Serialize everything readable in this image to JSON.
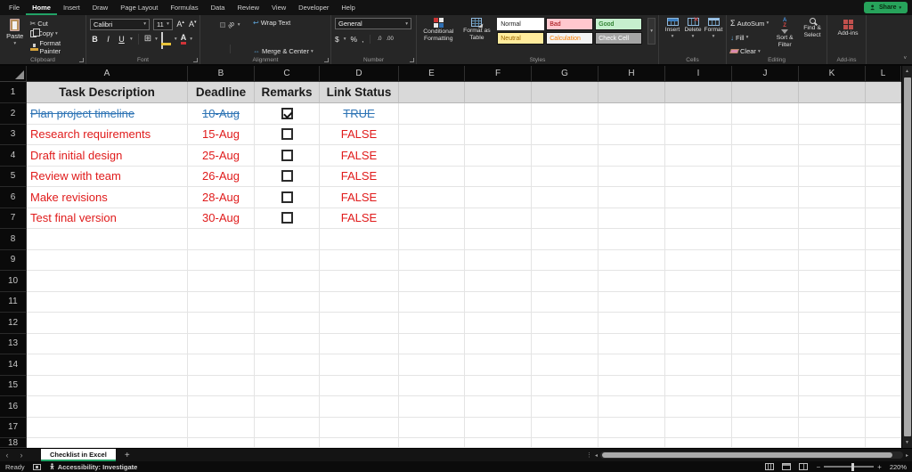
{
  "menu": {
    "items": [
      "File",
      "Home",
      "Insert",
      "Draw",
      "Page Layout",
      "Formulas",
      "Data",
      "Review",
      "View",
      "Developer",
      "Help"
    ],
    "active": "Home"
  },
  "titlebar": {
    "share_label": "Share"
  },
  "ribbon": {
    "clipboard": {
      "group_label": "Clipboard",
      "paste_label": "Paste",
      "cut_label": "Cut",
      "copy_label": "Copy",
      "format_painter_label": "Format Painter"
    },
    "font": {
      "group_label": "Font",
      "font_name": "Calibri",
      "font_size": "11",
      "bold": "B",
      "italic": "I",
      "underline": "U",
      "grow_font": "A",
      "shrink_font": "A"
    },
    "alignment": {
      "group_label": "Alignment",
      "wrap_text_label": "Wrap Text",
      "merge_center_label": "Merge & Center"
    },
    "number": {
      "group_label": "Number",
      "format_value": "General",
      "currency": "$",
      "percent": "%",
      "comma": ",",
      "increase_decimal": ".0",
      "decrease_decimal": ".00"
    },
    "styles": {
      "group_label": "Styles",
      "conditional_formatting_label": "Conditional Formatting",
      "format_as_table_label": "Format as Table",
      "cells": [
        {
          "name": "Normal",
          "bg": "#FFFFFF",
          "fg": "#1a1a1a",
          "emphasis": true
        },
        {
          "name": "Bad",
          "bg": "#FFC7CE",
          "fg": "#9C0006",
          "emphasis": false
        },
        {
          "name": "Good",
          "bg": "#C6EFCE",
          "fg": "#006100",
          "emphasis": false
        },
        {
          "name": "Neutral",
          "bg": "#FFEB9C",
          "fg": "#9C6500",
          "emphasis": false
        },
        {
          "name": "Calculation",
          "bg": "#F2F2F2",
          "fg": "#FA7D00",
          "emphasis": false
        },
        {
          "name": "Check Cell",
          "bg": "#A5A5A5",
          "fg": "#FFFFFF",
          "emphasis": false
        }
      ]
    },
    "cells": {
      "group_label": "Cells",
      "insert_label": "Insert",
      "delete_label": "Delete",
      "format_label": "Format"
    },
    "editing": {
      "group_label": "Editing",
      "autosum_label": "AutoSum",
      "fill_label": "Fill",
      "clear_label": "Clear",
      "sort_filter_label": "Sort & Filter",
      "find_select_label": "Find & Select"
    },
    "addins": {
      "group_label": "Add-ins",
      "button_label": "Add-ins"
    }
  },
  "grid": {
    "columns": [
      "A",
      "B",
      "C",
      "D",
      "E",
      "F",
      "G",
      "H",
      "I",
      "J",
      "K",
      "L"
    ],
    "row_numbers": [
      "1",
      "2",
      "3",
      "4",
      "5",
      "6",
      "7",
      "8",
      "9",
      "10",
      "11",
      "12",
      "13",
      "14",
      "15",
      "16",
      "17",
      "18"
    ],
    "header_row": [
      "Task Description",
      "Deadline",
      "Remarks",
      "Link Status"
    ],
    "tasks": [
      {
        "row": 2,
        "task": "Plan project timeline",
        "deadline": "10-Aug",
        "checked": true,
        "status": "TRUE",
        "done": true
      },
      {
        "row": 3,
        "task": "Research requirements",
        "deadline": "15-Aug",
        "checked": false,
        "status": "FALSE",
        "done": false
      },
      {
        "row": 4,
        "task": "Draft initial design",
        "deadline": "25-Aug",
        "checked": false,
        "status": "FALSE",
        "done": false
      },
      {
        "row": 5,
        "task": "Review with team",
        "deadline": "26-Aug",
        "checked": false,
        "status": "FALSE",
        "done": false
      },
      {
        "row": 6,
        "task": "Make revisions",
        "deadline": "28-Aug",
        "checked": false,
        "status": "FALSE",
        "done": false
      },
      {
        "row": 7,
        "task": "Test final version",
        "deadline": "30-Aug",
        "checked": false,
        "status": "FALSE",
        "done": false
      }
    ]
  },
  "sheet_tabs": {
    "active_tab": "Checklist in Excel",
    "add_sheet": "+"
  },
  "status_bar": {
    "mode": "Ready",
    "accessibility": "Accessibility: Investigate",
    "zoom_level": "220%"
  },
  "icons": {
    "dropdown": "▾",
    "scissors": "✂",
    "borders": "⊞",
    "wrap_arrow": "↩",
    "merge_arrows": "⇔",
    "sigma": "Σ",
    "fill_down": "↓",
    "tab_prev": "‹",
    "tab_next": "›",
    "hscroll_left": "◂",
    "hscroll_right": "▸",
    "vscroll_up": "▲",
    "vscroll_down": "▼",
    "dots": "⋮",
    "minus": "−",
    "plus": "+",
    "more": "▾",
    "collapse": "˅"
  },
  "colors": {
    "accent_green": "#21A366",
    "done_blue": "#2E74B5",
    "pending_red": "#E01B1B",
    "header_fill": "#D9D9D9"
  }
}
